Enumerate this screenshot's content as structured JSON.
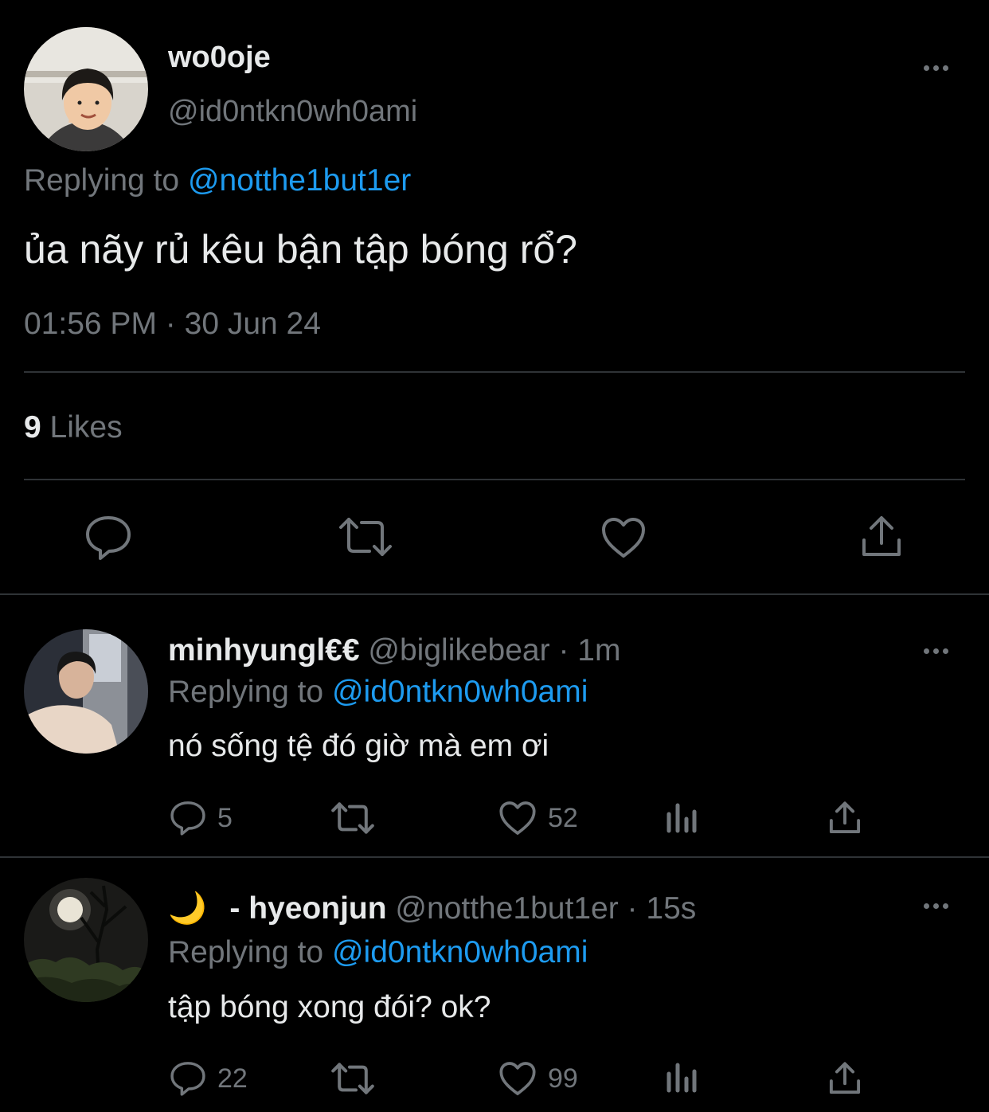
{
  "main_tweet": {
    "display_name": "wo0oje",
    "handle": "@id0ntkn0wh0ami",
    "replying_prefix": "Replying to",
    "replying_handle": "@notthe1but1er",
    "text": "ủa nãy rủ kêu bận tập bóng rổ?",
    "time": "01:56 PM",
    "separator": "·",
    "date": "30 Jun 24",
    "likes_count": "9",
    "likes_label": "Likes",
    "avatar_icon": "user-avatar-peace-sign"
  },
  "replies": [
    {
      "display_name": "minhyungl€€",
      "handle": "@biglikebear",
      "separator": "·",
      "time": "1m",
      "replying_prefix": "Replying to",
      "replying_handle": "@id0ntkn0wh0ami",
      "text": "nó sống tệ đó giờ mà em ơi",
      "reply_count": "5",
      "like_count": "52",
      "avatar_icon": "user-avatar-elevator"
    },
    {
      "emoji": "🌙",
      "display_name": "- hyeonjun",
      "handle": "@notthe1but1er",
      "separator": "·",
      "time": "15s",
      "replying_prefix": "Replying to",
      "replying_handle": "@id0ntkn0wh0ami",
      "text": "tập bóng xong đói? ok?",
      "reply_count": "22",
      "like_count": "99",
      "avatar_icon": "user-avatar-moon-tree"
    }
  ],
  "colors": {
    "background": "#000000",
    "text": "#e7e9ea",
    "muted": "#71767b",
    "link": "#1d9bf0",
    "divider": "#2f3336"
  }
}
